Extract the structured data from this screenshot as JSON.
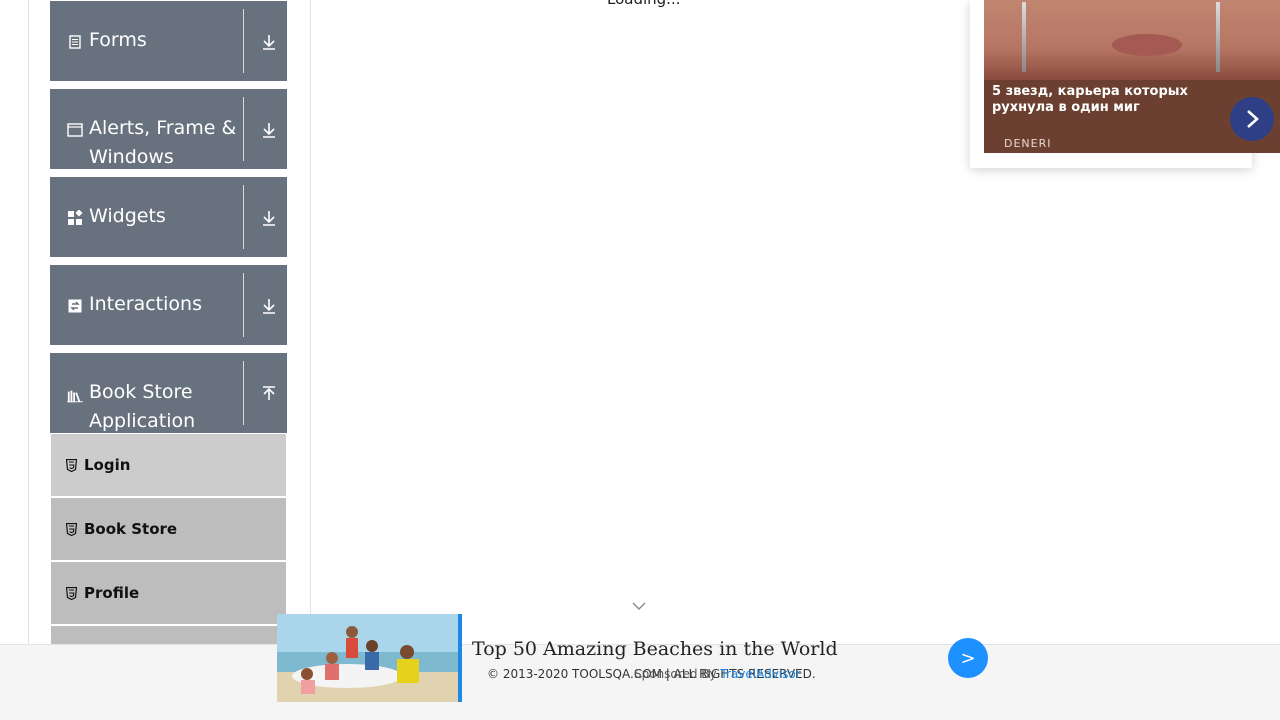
{
  "sidebar": {
    "groups": [
      {
        "label": "Forms",
        "icon": "form-icon",
        "expanded": false
      },
      {
        "label": "Alerts, Frame &",
        "label2": "Windows",
        "icon": "window-icon",
        "expanded": false
      },
      {
        "label": "Widgets",
        "icon": "widgets-icon",
        "expanded": false
      },
      {
        "label": "Interactions",
        "icon": "interactions-icon",
        "expanded": false
      },
      {
        "label": "Book Store",
        "label2": "Application",
        "icon": "book-icon",
        "expanded": true
      }
    ],
    "book_store_items": [
      {
        "label": "Login",
        "icon": "html5-icon"
      },
      {
        "label": "Book Store",
        "icon": "html5-icon"
      },
      {
        "label": "Profile",
        "icon": "html5-icon"
      }
    ]
  },
  "main": {
    "loading_text": "Loading..."
  },
  "ad_top": {
    "caption": "5 звезд, карьера которых рухнула в один миг",
    "brand": "DENERI"
  },
  "ad_bottom": {
    "title": "Top 50 Amazing Beaches in the World",
    "sponsor_prefix": "Sponsored By",
    "sponsor_source": "TravelAdvisor"
  },
  "footer": {
    "copyright": "© 2013-2020 TOOLSQA.COM | ALL RIGHTS RESERVED."
  },
  "colors": {
    "group_bg": "#68727f",
    "item_bg_1": "#cccccc",
    "item_bg_2": "#bdbdbd",
    "ad_button": "#1e90ff"
  }
}
